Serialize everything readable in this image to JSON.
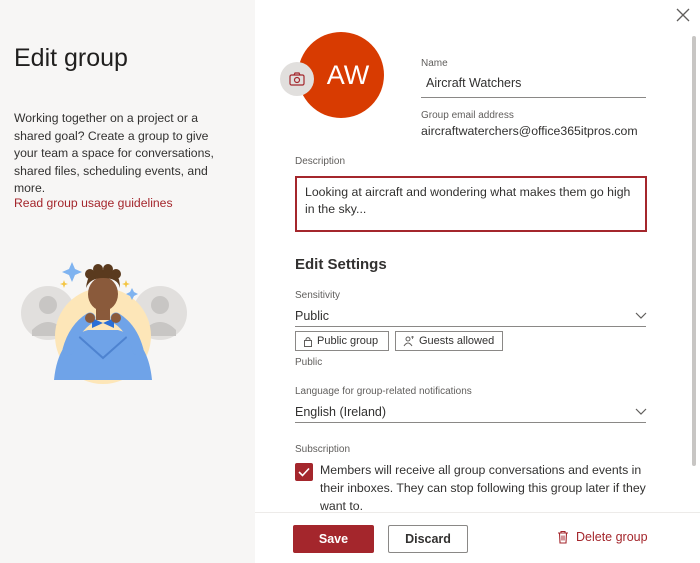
{
  "left": {
    "title": "Edit group",
    "description": "Working together on a project or a shared goal? Create a group to give your team a space for conversations, shared files, scheduling events, and more.",
    "guidelines_link": "Read group usage guidelines"
  },
  "group": {
    "initials": "AW",
    "avatar_color": "#d83b01",
    "name_label": "Name",
    "name_value": "Aircraft Watchers",
    "email_label": "Group email address",
    "email_value": "aircraftwaterchers@office365itpros.com",
    "description_label": "Description",
    "description_value": "Looking at aircraft and wondering what makes them go high in the sky..."
  },
  "settings": {
    "title": "Edit Settings",
    "sensitivity_label": "Sensitivity",
    "sensitivity_value": "Public",
    "pill_public": "Public group",
    "pill_guests": "Guests allowed",
    "privacy_text": "Public",
    "language_label": "Language for group-related notifications",
    "language_value": "English (Ireland)",
    "subscription_label": "Subscription",
    "subscription_text": "Members will receive all group conversations and events in their inboxes. They can stop following this group later if they want to.",
    "subscription_checked": true
  },
  "footer": {
    "save_label": "Save",
    "discard_label": "Discard",
    "delete_label": "Delete group"
  },
  "colors": {
    "accent": "#a4262c",
    "left_bg": "#f7f6f5"
  }
}
